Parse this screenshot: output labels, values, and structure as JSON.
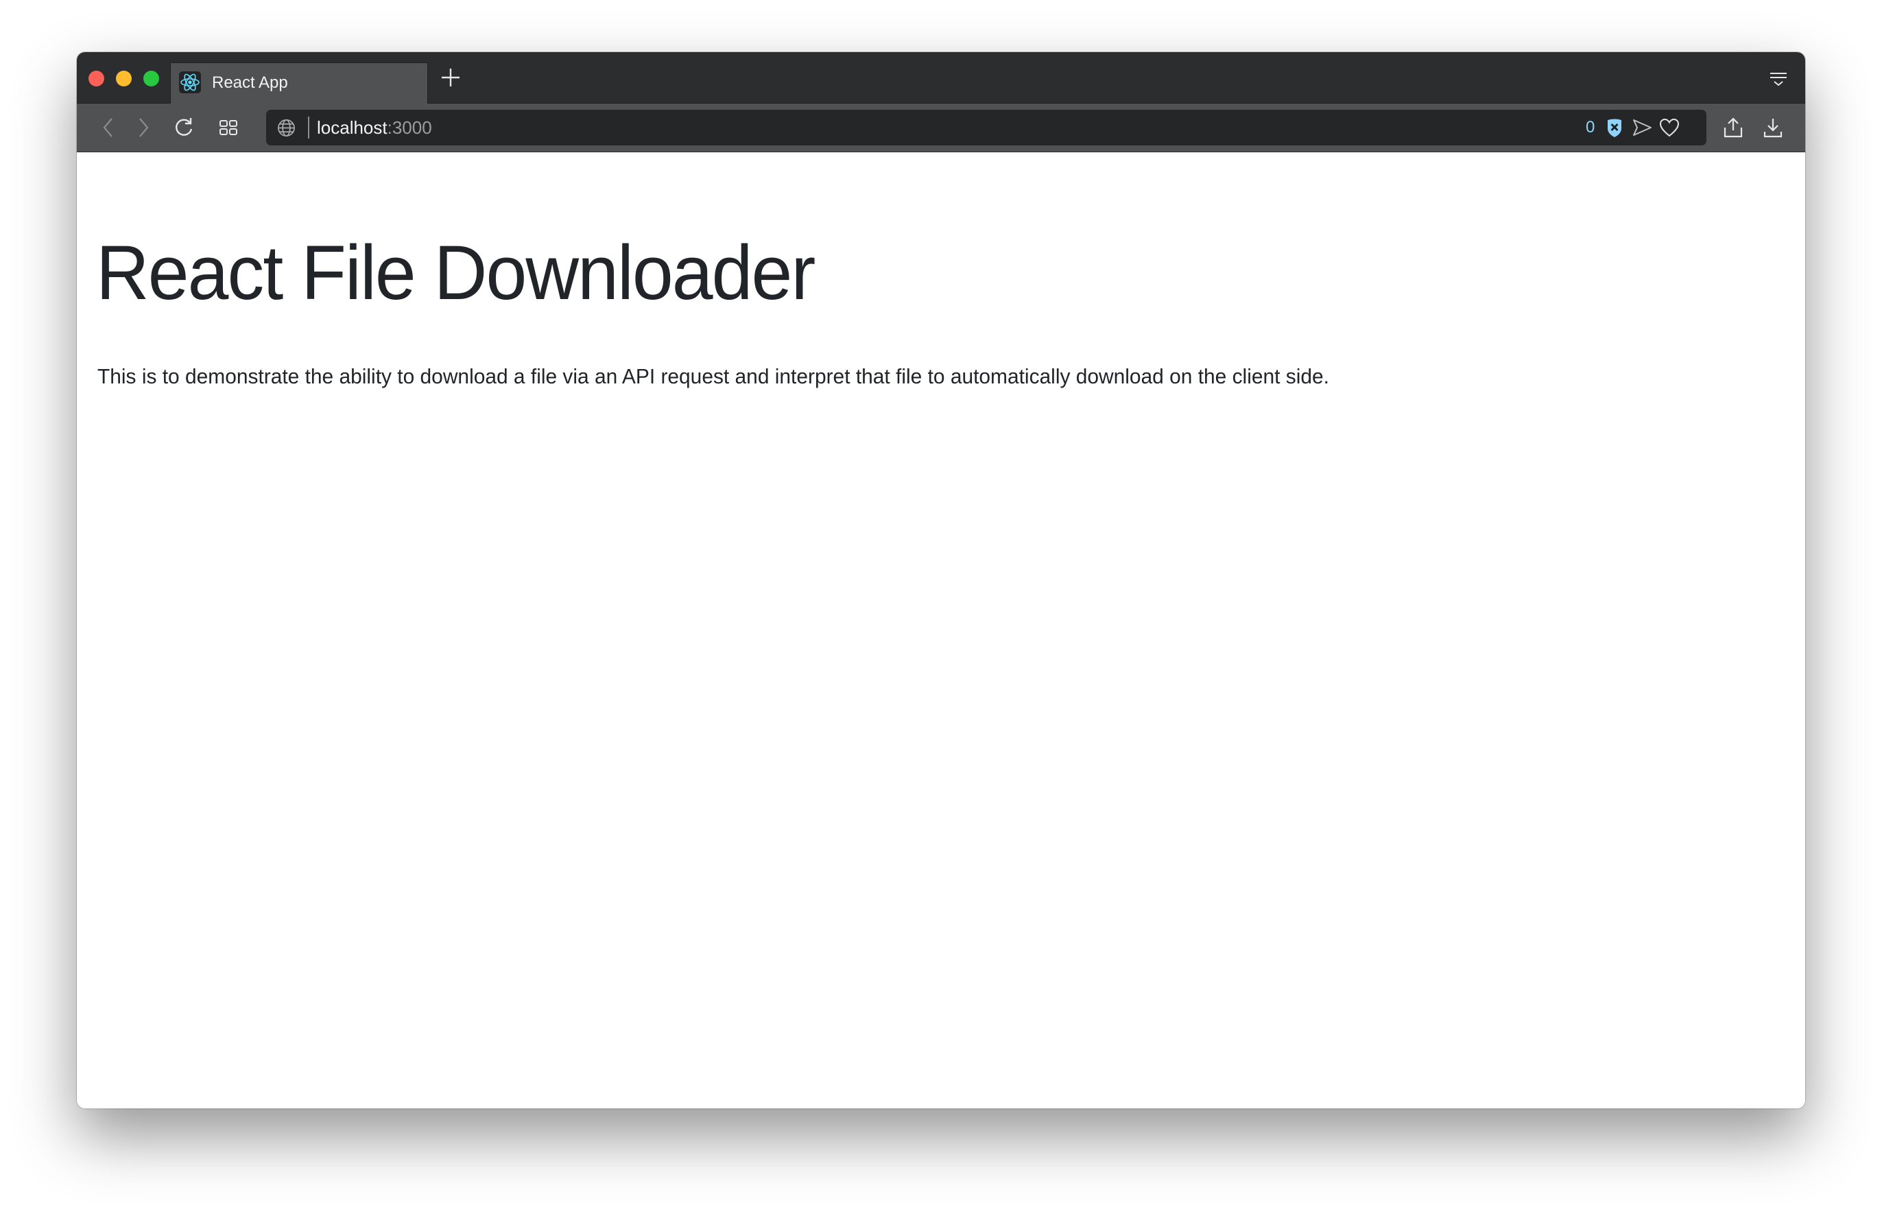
{
  "browser": {
    "tabs": [
      {
        "title": "React App",
        "favicon": "react-logo-icon",
        "active": true
      }
    ],
    "new_tab_icon": "plus-icon",
    "tab_menu_icon": "tab-list-icon",
    "toolbar": {
      "back_icon": "chevron-left-icon",
      "forward_icon": "chevron-right-icon",
      "reload_icon": "reload-icon",
      "grid_icon": "speed-dial-icon",
      "share_icon": "share-icon",
      "download_icon": "download-icon"
    },
    "address_bar": {
      "host": "localhost",
      "port": ":3000",
      "site_icon": "globe-icon",
      "blocked_count": "0",
      "shield_icon": "ad-block-shield-icon",
      "send_icon": "send-icon",
      "bookmark_icon": "heart-icon"
    },
    "colors": {
      "shield_accent": "#8fd3ff",
      "react_cyan": "#61dafb",
      "close": "#fe5f57",
      "minimize": "#febc2e",
      "maximize": "#28c840"
    }
  },
  "page": {
    "title": "React File Downloader",
    "description": "This is to demonstrate the ability to download a file via an API request and interpret that file to automatically download on the client side."
  }
}
